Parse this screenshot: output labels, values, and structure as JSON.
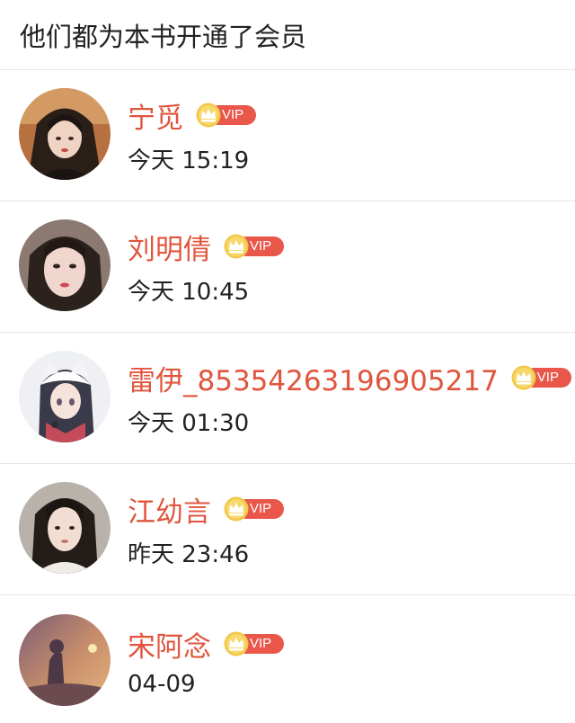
{
  "header": {
    "title": "他们都为本书开通了会员"
  },
  "badge": {
    "vip_label": "VIP",
    "accent": "#e8574a",
    "coin": "#f2c84b"
  },
  "colors": {
    "name": "#e0553d",
    "text": "#222222",
    "divider": "#e5e5e5"
  },
  "members": [
    {
      "name": "宁觅",
      "time": "今天 15:19",
      "avatar_icon": "avatar-photo-1"
    },
    {
      "name": "刘明倩",
      "time": "今天 10:45",
      "avatar_icon": "avatar-photo-2"
    },
    {
      "name": "雷伊_85354263196905217",
      "time": "今天 01:30",
      "avatar_icon": "avatar-anime-3"
    },
    {
      "name": "江幼言",
      "time": "昨天 23:46",
      "avatar_icon": "avatar-photo-4"
    },
    {
      "name": "宋阿念",
      "time": "04-09",
      "avatar_icon": "avatar-photo-5"
    }
  ]
}
